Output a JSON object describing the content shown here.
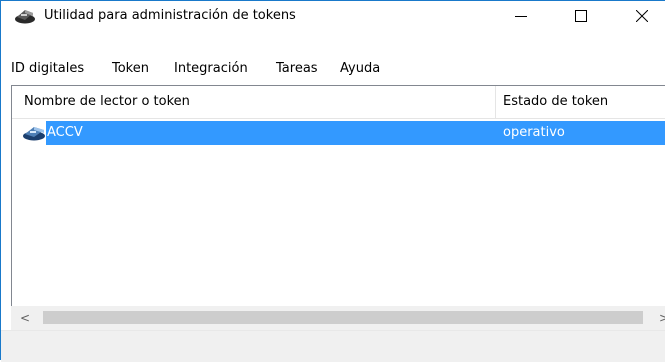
{
  "window": {
    "title": "Utilidad para administración de tokens",
    "accent_color": "#1979ca",
    "icon": "printer-token-icon"
  },
  "menu": {
    "items": [
      {
        "label": "ID digitales"
      },
      {
        "label": "Token"
      },
      {
        "label": "Integración"
      },
      {
        "label": "Tareas"
      },
      {
        "label": "Ayuda"
      }
    ]
  },
  "list": {
    "columns": [
      {
        "label": "Nombre de lector o token"
      },
      {
        "label": "Estado de token"
      }
    ],
    "rows": [
      {
        "name": "ACCV",
        "status": "operativo",
        "selected": true,
        "icon": "token-reader-icon"
      }
    ],
    "selection_color": "#3399ff"
  },
  "scrollbar": {
    "left_arrow": "<",
    "right_arrow": ">"
  }
}
